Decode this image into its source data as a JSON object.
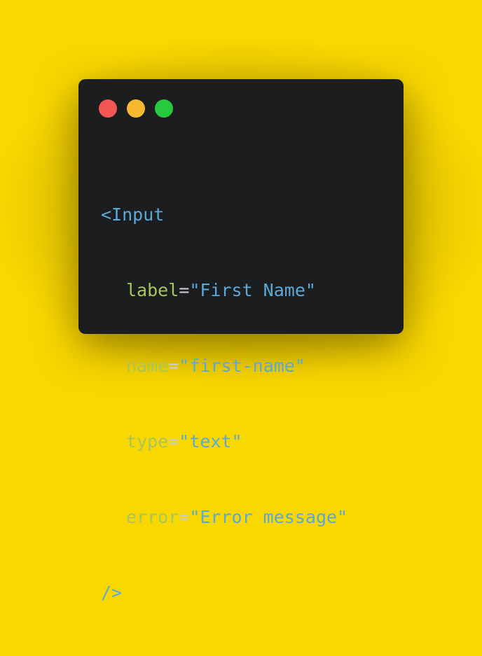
{
  "window": {
    "controls": [
      {
        "name": "close",
        "color": "#f25754"
      },
      {
        "name": "minimize",
        "color": "#f7b92f"
      },
      {
        "name": "maximize",
        "color": "#27c93f"
      }
    ]
  },
  "code": {
    "open_tag": "<Input",
    "attributes": [
      {
        "name": "label",
        "eq": "=",
        "value": "\"First Name\""
      },
      {
        "name": "name",
        "eq": "=",
        "value": "\"first-name\""
      },
      {
        "name": "type",
        "eq": "=",
        "value": "\"text\""
      },
      {
        "name": "error",
        "eq": "=",
        "value": "\"Error message\""
      }
    ],
    "close_tag": "/>"
  },
  "colors": {
    "background": "#f9d700",
    "window": "#1c1d1f",
    "tag": "#5aa9d9",
    "attribute": "#a8c65a",
    "string": "#5aa9d9",
    "punctuation": "#c8ccd2"
  }
}
